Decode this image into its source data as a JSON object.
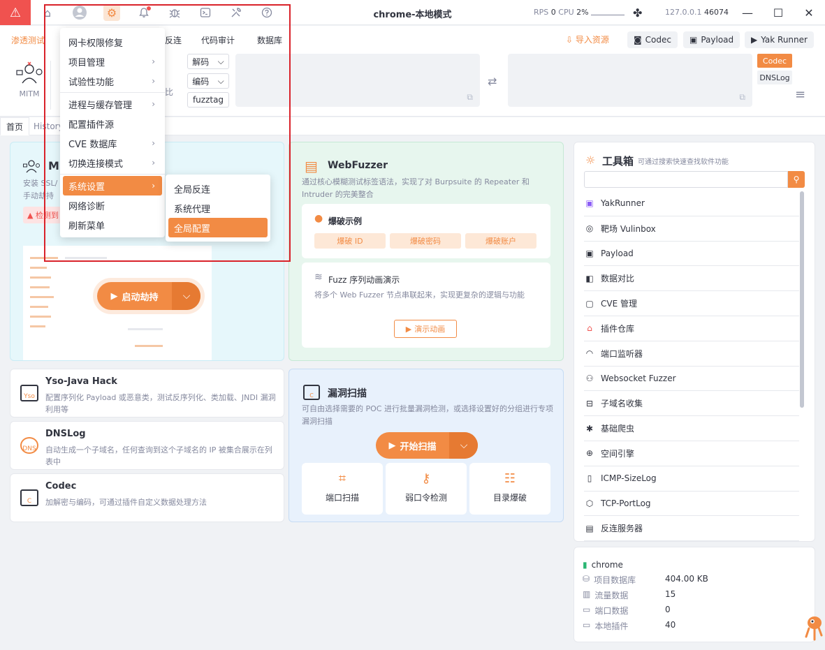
{
  "titlebar": {
    "title": "chrome-本地模式",
    "rps_label": "RPS",
    "rps_value": "0",
    "cpu_label": "CPU",
    "cpu_value": "2%",
    "ip": "127.0.0.1",
    "port": "46074"
  },
  "menurow": {
    "tabs": [
      "渗透测试",
      "反连",
      "代码审计",
      "数据库"
    ],
    "import_label": "导入资源",
    "buttons": [
      "Codec",
      "Payload",
      "Yak Runner"
    ]
  },
  "codec": {
    "mitm_label": "MITM",
    "decode": "解码",
    "encode": "编码",
    "fuzztag": "fuzztag",
    "compare_fragment": "比",
    "side_on": "Codec",
    "side_off": "DNSLog"
  },
  "pagetabs": [
    "首页",
    "History"
  ],
  "main_menu": {
    "items": [
      {
        "label": "网卡权限修复",
        "arrow": false
      },
      {
        "label": "项目管理",
        "arrow": true
      },
      {
        "label": "试验性功能",
        "arrow": true
      },
      {
        "label": "进程与缓存管理",
        "arrow": true
      },
      {
        "label": "配置插件源",
        "arrow": false
      },
      {
        "label": "CVE 数据库",
        "arrow": true
      },
      {
        "label": "切换连接模式",
        "arrow": true
      },
      {
        "label": "系统设置",
        "arrow": true
      },
      {
        "label": "网络诊断",
        "arrow": false
      },
      {
        "label": "刷新菜单",
        "arrow": false
      }
    ]
  },
  "sub_menu": {
    "items": [
      "全局反连",
      "系统代理",
      "全局配置"
    ]
  },
  "mitm_card": {
    "title": "M",
    "desc_line1": "安装 SSL/",
    "desc_line2": "手动劫持",
    "warn_tag": "▲ 检测到",
    "launch": "启动劫持"
  },
  "webfuzzer": {
    "title": "WebFuzzer",
    "desc": "通过核心模糊测试标签语法，实现了对 Burpsuite 的 Repeater 和 Intruder 的完美整合",
    "burst_title": "爆破示例",
    "burst_buttons": [
      "爆破 ID",
      "爆破密码",
      "爆破账户"
    ],
    "fuzz_title": "Fuzz 序列动画演示",
    "fuzz_desc": "将多个 Web Fuzzer 节点串联起来，实现更复杂的逻辑与功能",
    "demo": "演示动画"
  },
  "tools": [
    {
      "title": "Yso-Java Hack",
      "desc": "配置序列化 Payload 或恶意类，测试反序列化、类加载、JNDI 漏洞利用等",
      "icon_text": "Yso"
    },
    {
      "title": "DNSLog",
      "desc": "自动生成一个子域名，任何查询到这个子域名的 IP 被集合展示在列表中",
      "icon_text": "DNS"
    },
    {
      "title": "Codec",
      "desc": "加解密与编码，可通过插件自定义数据处理方法",
      "icon_text": "C"
    }
  ],
  "vuln": {
    "title": "漏洞扫描",
    "desc": "可自由选择需要的 POC 进行批量漏洞检测，或选择设置好的分组进行专项漏洞扫描",
    "scan": "开始扫描",
    "mini_tools": [
      "端口扫描",
      "弱口令检测",
      "目录爆破"
    ]
  },
  "toolbox": {
    "title": "工具箱",
    "subtitle": "可通过搜索快速查找软件功能",
    "items": [
      "YakRunner",
      "靶场 Vulinbox",
      "Payload",
      "数据对比",
      "CVE 管理",
      "插件仓库",
      "端口监听器",
      "Websocket Fuzzer",
      "子域名收集",
      "基础爬虫",
      "空间引擎",
      "ICMP-SizeLog",
      "TCP-PortLog",
      "反连服务器"
    ]
  },
  "project": {
    "name": "chrome",
    "rows": [
      {
        "label": "项目数据库",
        "value": "404.00 KB"
      },
      {
        "label": "流量数据",
        "value": "15"
      },
      {
        "label": "端口数据",
        "value": "0"
      },
      {
        "label": "本地插件",
        "value": "40"
      }
    ]
  },
  "colors": {
    "accent": "#f28b44",
    "danger": "#f0524f",
    "highlight_frame": "#d9222a"
  }
}
